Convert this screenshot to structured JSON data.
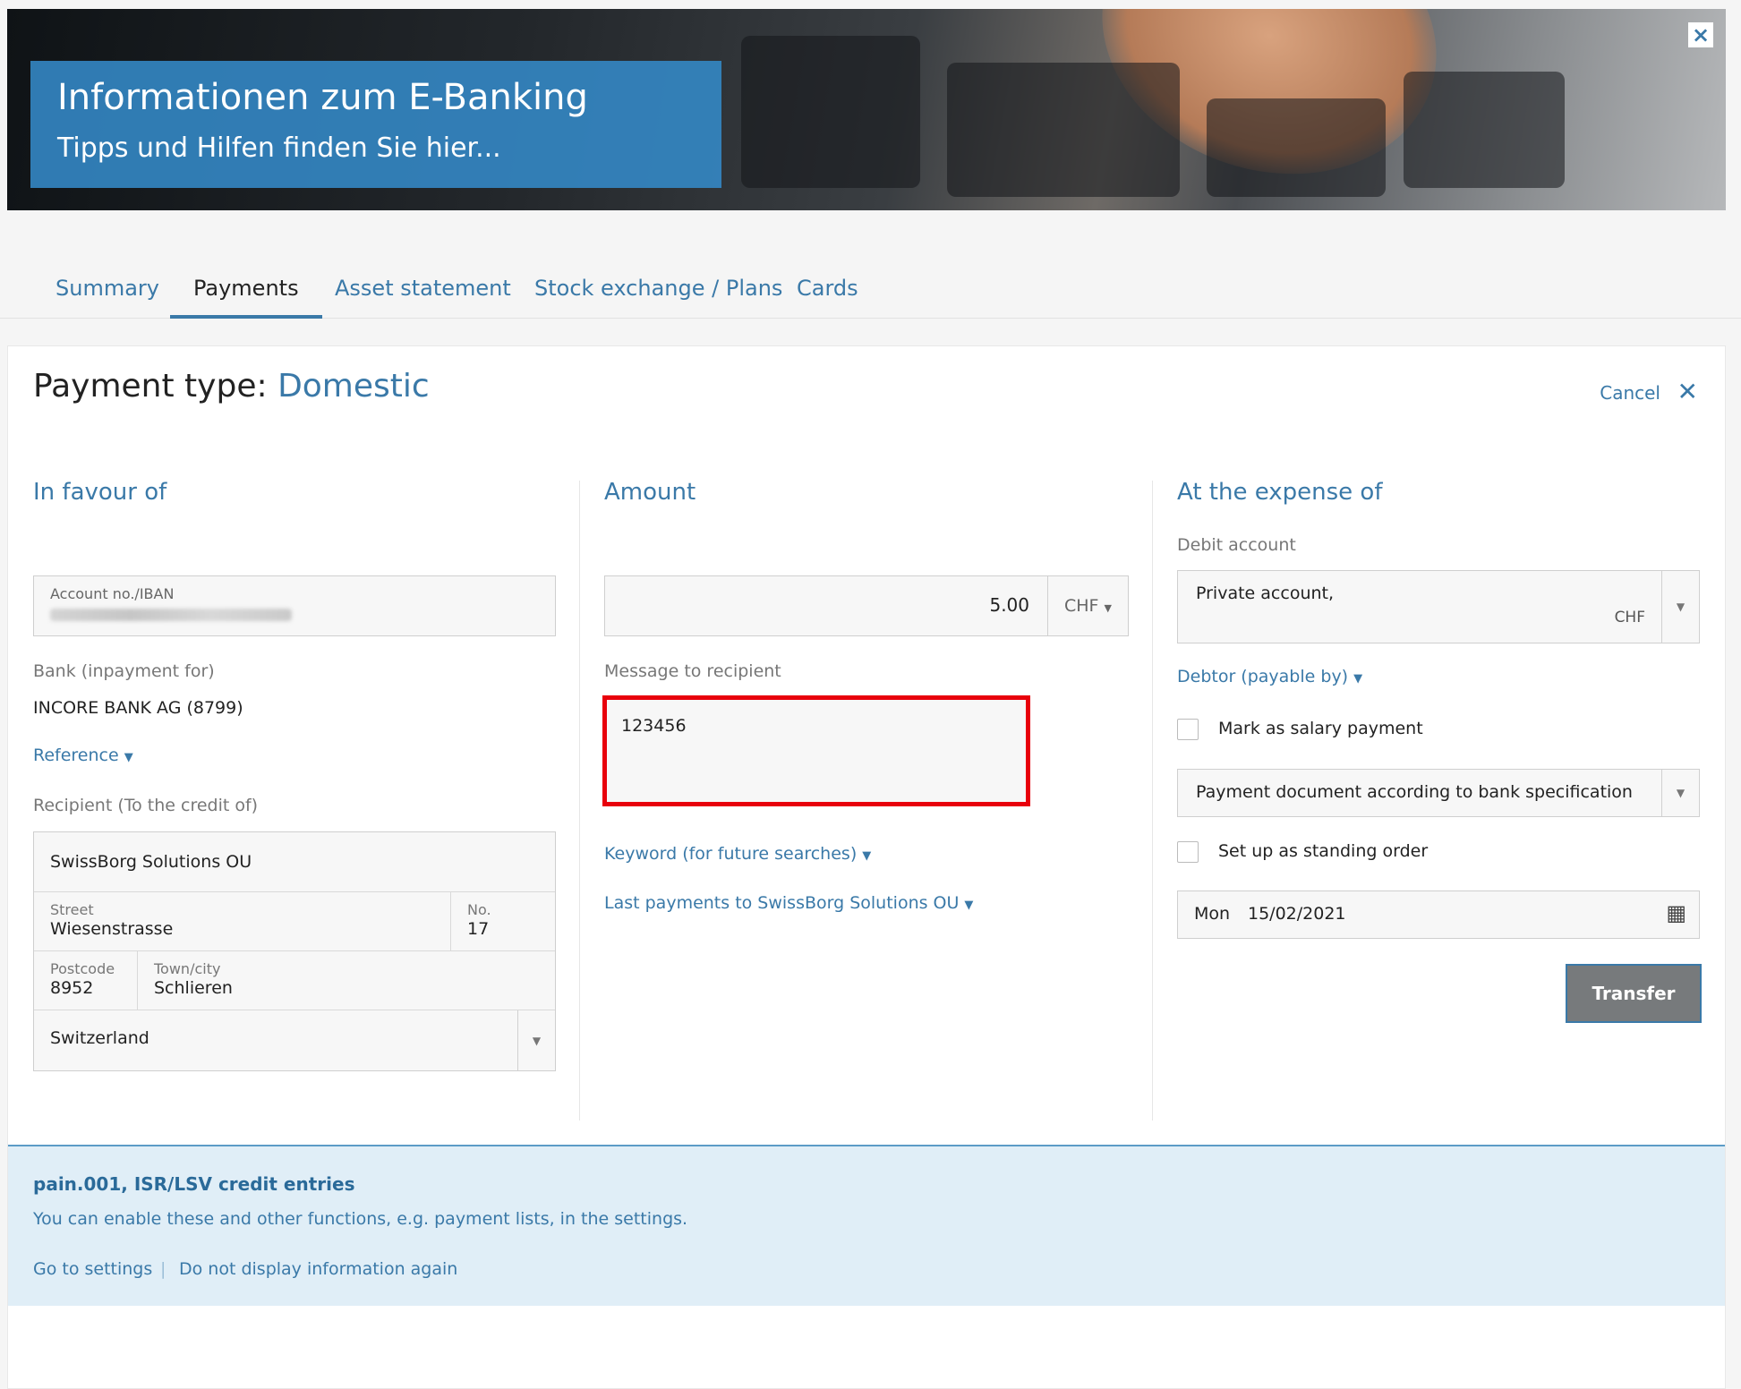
{
  "banner": {
    "title": "Informationen zum E-Banking",
    "subtitle": "Tipps und Hilfen finden Sie hier...",
    "close_icon": "×"
  },
  "tabs": [
    {
      "label": "Summary"
    },
    {
      "label": "Payments"
    },
    {
      "label": "Asset statement"
    },
    {
      "label": "Stock exchange / Plans"
    },
    {
      "label": "Cards"
    }
  ],
  "payment": {
    "title_prefix": "Payment type:",
    "type": "Domestic",
    "cancel_label": "Cancel",
    "cancel_icon": "✕"
  },
  "favour": {
    "heading": "In favour of",
    "account_label": "Account no./IBAN",
    "bank_label": "Bank (inpayment for)",
    "bank_value": "INCORE BANK AG (8799)",
    "reference_link": "Reference",
    "recipient_label": "Recipient (To the credit of)",
    "recipient_name": "SwissBorg Solutions OU",
    "street_label": "Street",
    "street_value": "Wiesenstrasse",
    "no_label": "No.",
    "no_value": "17",
    "postcode_label": "Postcode",
    "postcode_value": "8952",
    "town_label": "Town/city",
    "town_value": "Schlieren",
    "country_value": "Switzerland"
  },
  "amount": {
    "heading": "Amount",
    "value": "5.00",
    "currency": "CHF",
    "message_label": "Message to recipient",
    "message_value": "123456",
    "keyword_link": "Keyword (for future searches)",
    "last_payments_link": "Last payments to SwissBorg Solutions OU"
  },
  "expense": {
    "heading": "At the expense of",
    "debit_label": "Debit account",
    "debit_account": "Private account,",
    "debit_currency": "CHF",
    "debtor_link": "Debtor (payable by)",
    "salary_checkbox": "Mark as salary payment",
    "document_select": "Payment document according to bank specification",
    "standing_order_checkbox": "Set up as standing order",
    "date_day": "Mon",
    "date_value": "15/02/2021",
    "calendar_icon": "▦",
    "transfer_button": "Transfer"
  },
  "info": {
    "heading": "pain.001, ISR/LSV credit entries",
    "text": "You can enable these and other functions, e.g. payment lists, in the settings.",
    "settings_link": "Go to settings",
    "separator": "|",
    "hide_link": "Do not display information again"
  },
  "colors": {
    "accent": "#3a79a8",
    "highlight_border": "#e8000c",
    "info_bg": "#e0eef7"
  }
}
